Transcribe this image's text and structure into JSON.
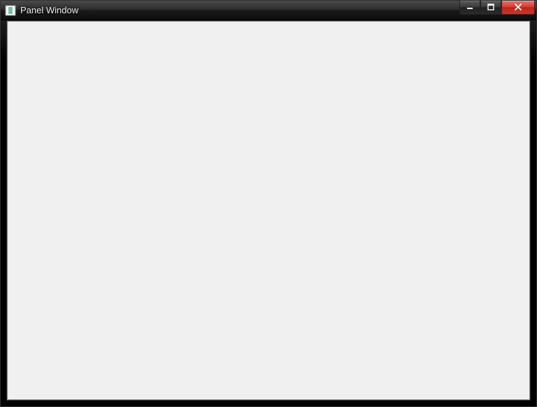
{
  "window": {
    "title": "Panel Window"
  }
}
